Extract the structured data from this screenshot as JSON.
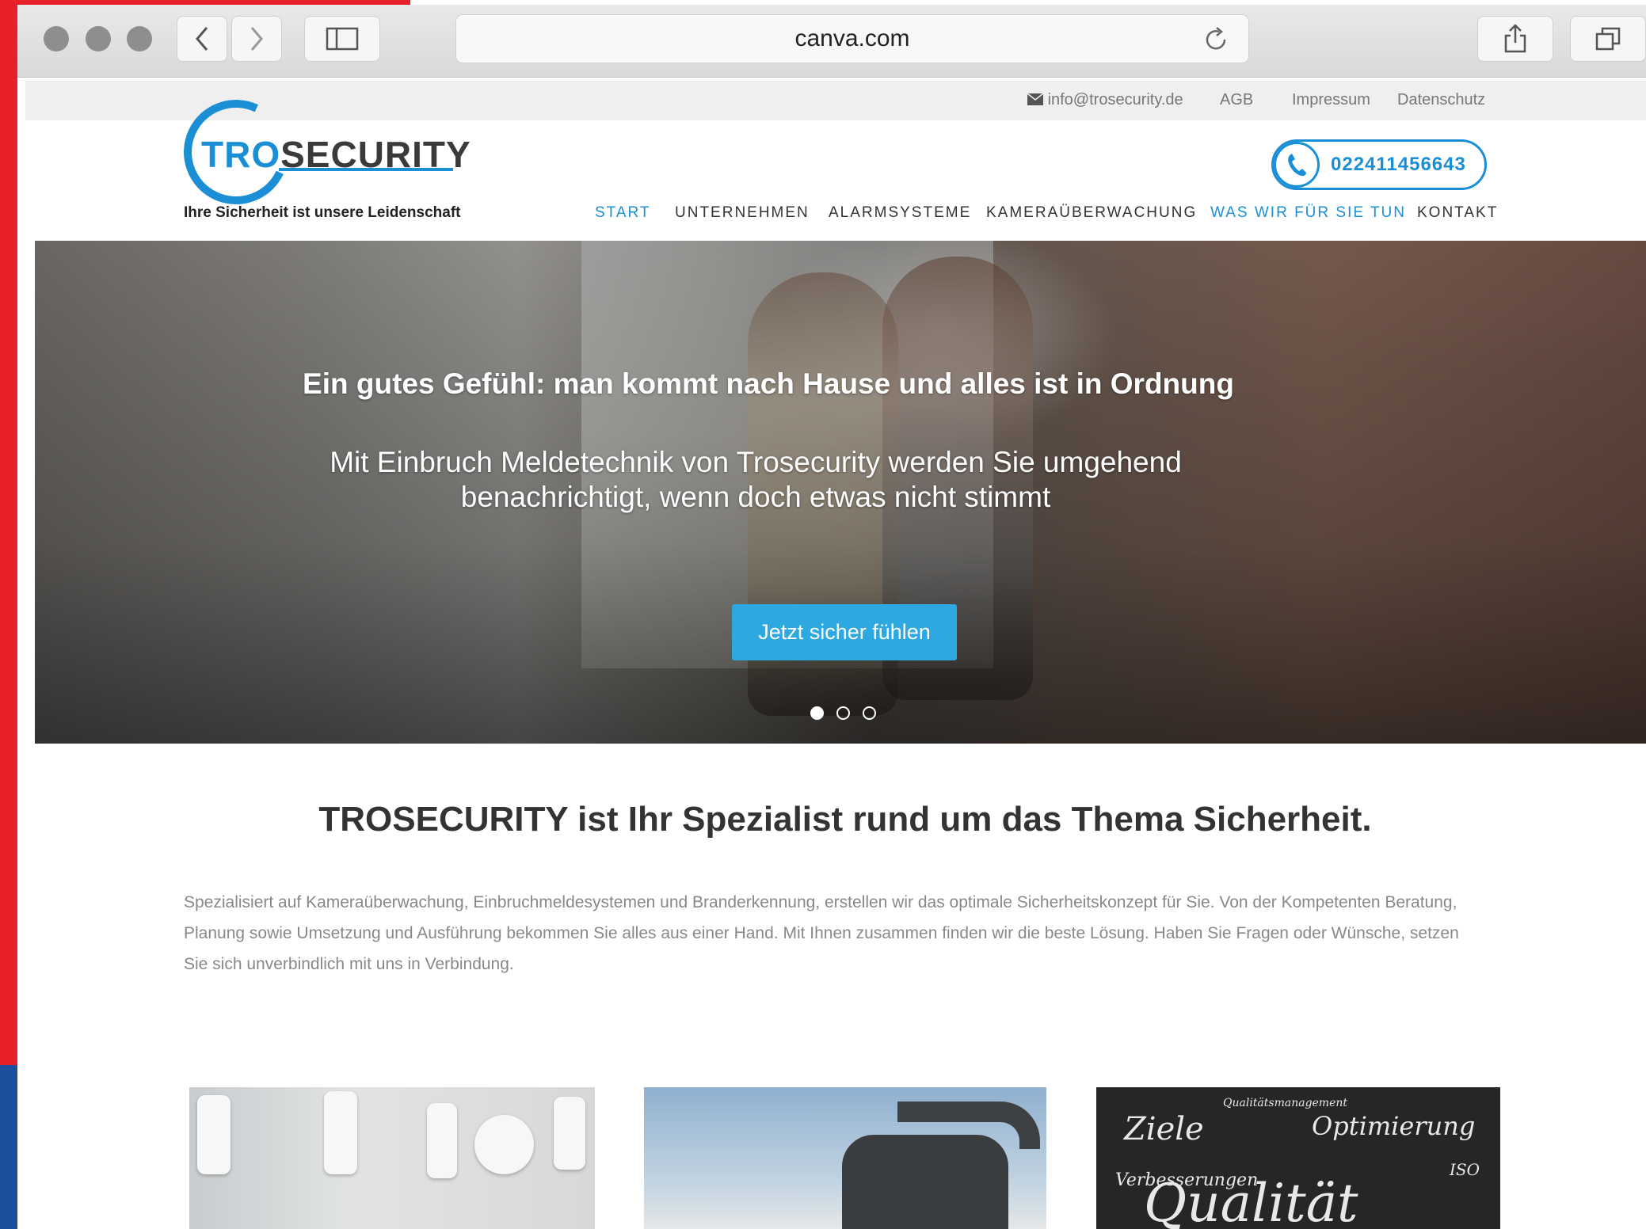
{
  "browser": {
    "url": "canva.com"
  },
  "topbar": {
    "email": "info@trosecurity.de",
    "links": [
      "AGB",
      "Impressum",
      "Datenschutz"
    ]
  },
  "header": {
    "logo_tro": "TRO",
    "logo_security": "SECURITY",
    "tagline": "Ihre Sicherheit ist unsere Leidenschaft",
    "phone": "022411456643"
  },
  "nav": {
    "items": [
      "START",
      "UNTERNEHMEN",
      "ALARMSYSTEME",
      "KAMERAÜBERWACHUNG",
      "WAS WIR FÜR SIE TUN",
      "KONTAKT"
    ],
    "active": [
      "START",
      "WAS WIR FÜR SIE TUN"
    ]
  },
  "hero": {
    "title": "Ein gutes Gefühl: man kommt nach Hause und alles ist in Ordnung",
    "subtitle": "Mit Einbruch Meldetechnik von Trosecurity werden Sie umgehend benachrichtigt, wenn doch etwas nicht stimmt",
    "cta": "Jetzt sicher fühlen",
    "slides": 3,
    "active_slide": 1
  },
  "intro": {
    "title": "TROSECURITY ist Ihr Spezialist rund um das Thema Sicherheit.",
    "text": "Spezialisiert auf Kameraüberwachung, Einbruchmeldesystemen und Branderkennung, erstellen wir das optimale Sicherheitskonzept für Sie. Von der Kompetenten Beratung, Planung sowie Umsetzung und Ausführung bekommen Sie alles aus einer Hand. Mit Ihnen zusammen finden wir die beste Lösung. Haben Sie Fragen oder Wünsche, setzen Sie sich unverbindlich mit uns in Verbindung."
  },
  "thumbnails": {
    "chalkboard_words": [
      "Ziele",
      "Qualitätsmanagement",
      "Optimierung",
      "Verbesserungen",
      "ISO",
      "Qualität"
    ]
  },
  "colors": {
    "accent": "#1a8fd6",
    "cta": "#2ea8e0",
    "stripe_red": "#e8202a",
    "stripe_blue": "#1d4f9c"
  }
}
